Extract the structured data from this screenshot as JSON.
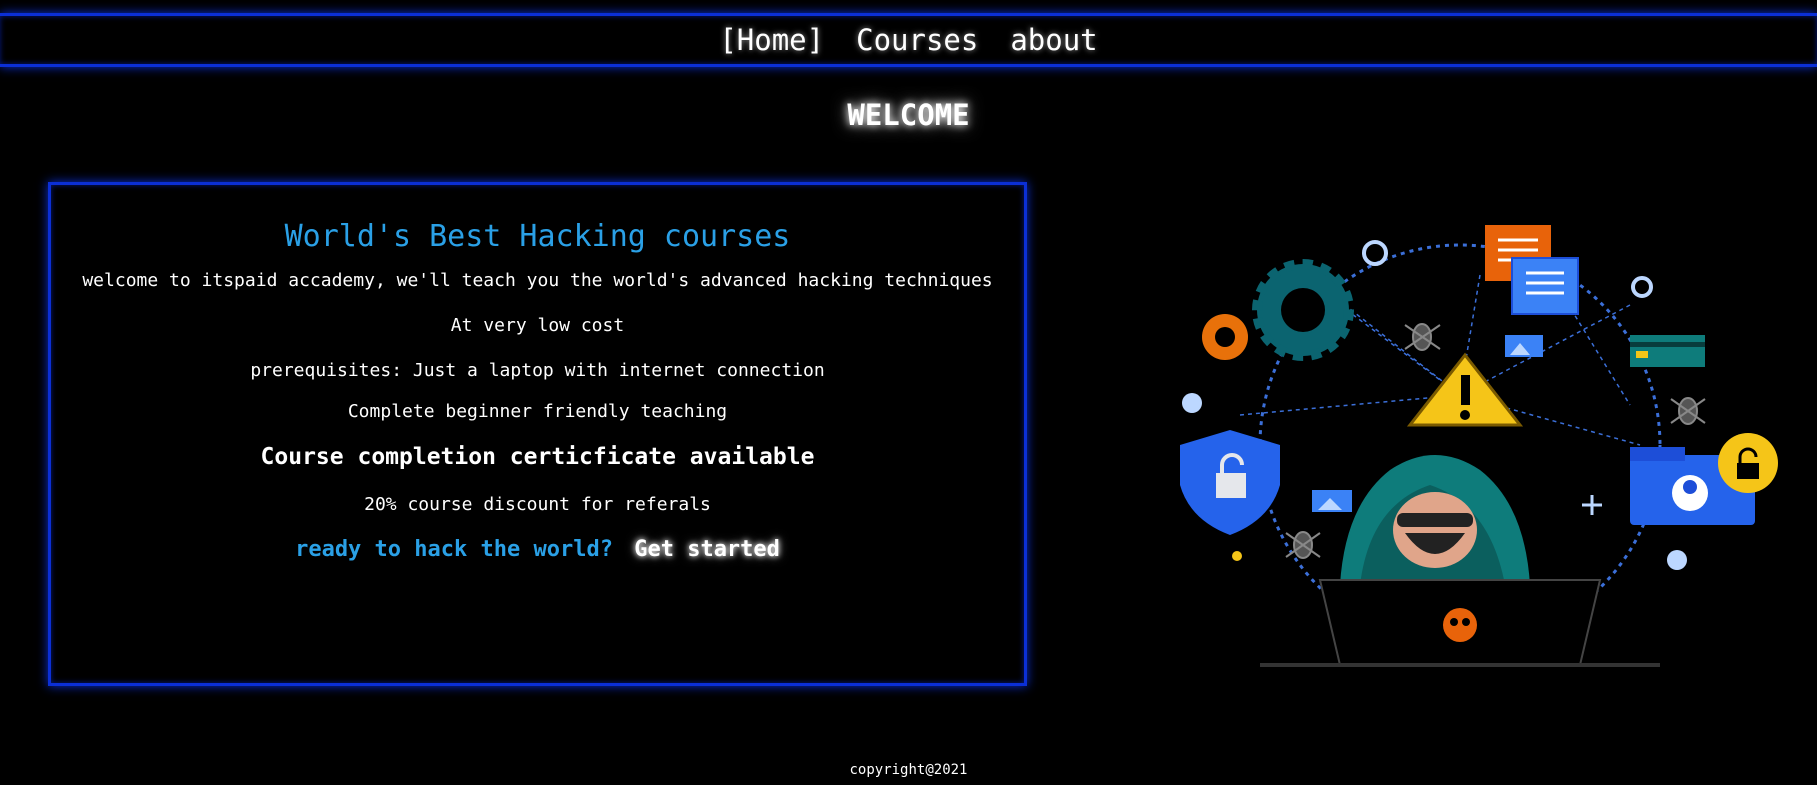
{
  "nav": {
    "home": "[Home]",
    "courses": "Courses",
    "about": "about"
  },
  "welcome": "WELCOME",
  "card": {
    "title": "World's Best Hacking courses",
    "intro": "welcome to itspaid accademy, we'll teach you the world's advanced hacking techniques",
    "cost": "At very low cost",
    "prereq": "prerequisites: Just a laptop with internet connection",
    "beginner": "Complete beginner friendly teaching",
    "certificate": "Course completion certicficate available",
    "discount": "20% course discount for referals",
    "cta_question": "ready to hack the world?",
    "cta_button": "Get started"
  },
  "footer": "copyright@2021",
  "colors": {
    "accent_blue": "#2aa0e6",
    "border_blue": "#0b2fd6",
    "background": "#000000"
  },
  "illustration": {
    "icons": [
      "gear-icon",
      "document-icon",
      "warning-icon",
      "shield-lock-icon",
      "credit-card-icon",
      "folder-user-icon",
      "padlock-icon",
      "image-icon",
      "bug-icon",
      "skull-icon",
      "hooded-hacker-figure",
      "laptop-icon"
    ]
  }
}
